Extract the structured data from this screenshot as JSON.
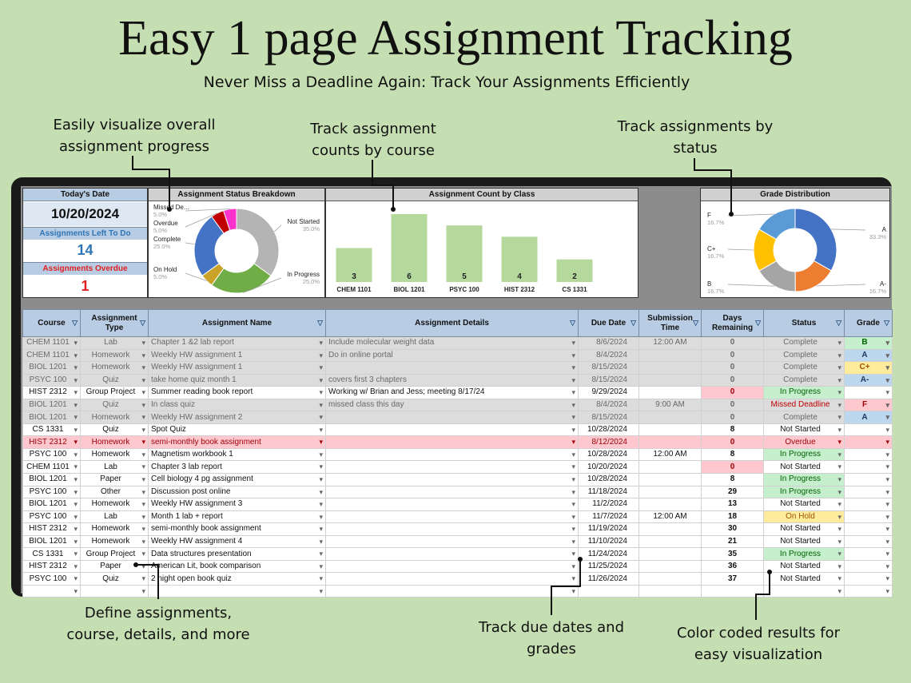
{
  "title": "Easy 1 page Assignment Tracking",
  "subtitle": "Never Miss a Deadline Again: Track Your Assignments Efficiently",
  "callouts": {
    "progress": [
      "Easily visualize overall",
      "assignment progress"
    ],
    "counts": [
      "Track assignment",
      "counts by course"
    ],
    "status": [
      "Track assignments by",
      "status"
    ],
    "define": [
      "Define assignments,",
      "course, details, and more"
    ],
    "due": [
      "Track due dates and",
      "grades"
    ],
    "color": [
      "Color coded results for",
      "easy visualization"
    ]
  },
  "kpis": {
    "today_label": "Today's Date",
    "today_value": "10/20/2024",
    "left_label": "Assignments Left To Do",
    "left_value": "14",
    "overdue_label": "Assignments Overdue",
    "overdue_value": "1",
    "colors": {
      "left": "#2e75b6",
      "overdue": "#e02020"
    }
  },
  "status_chart": {
    "title": "Assignment Status Breakdown",
    "slices": [
      {
        "label": "Not Started",
        "pct": "35.0%",
        "value": 35,
        "color": "#b4b4b4"
      },
      {
        "label": "In Progress",
        "pct": "25.0%",
        "value": 25,
        "color": "#70ad47"
      },
      {
        "label": "On Hold",
        "pct": "5.0%",
        "value": 5,
        "color": "#c9a227"
      },
      {
        "label": "Complete",
        "pct": "25.0%",
        "value": 25,
        "color": "#4472c4"
      },
      {
        "label": "Overdue",
        "pct": "5.0%",
        "value": 5,
        "color": "#c00000"
      },
      {
        "label": "Missed De...",
        "pct": "5.0%",
        "value": 5,
        "color": "#ff33cc"
      }
    ]
  },
  "chart_data": [
    {
      "type": "bar",
      "title": "Assignment Count by Class",
      "categories": [
        "CHEM 1101",
        "BIOL 1201",
        "PSYC 100",
        "HIST 2312",
        "CS 1331"
      ],
      "values": [
        3,
        6,
        5,
        4,
        2
      ],
      "color": "#b5d99c",
      "ylim": [
        0,
        6.5
      ]
    },
    {
      "type": "pie",
      "title": "Grade Distribution",
      "categories": [
        "A",
        "A-",
        "B",
        "C+",
        "F"
      ],
      "values": [
        33.3,
        16.7,
        16.7,
        16.7,
        16.7
      ],
      "labels": [
        "33.3%",
        "16.7%",
        "16.7%",
        "16.7%",
        "16.7%"
      ],
      "colors": [
        "#4472c4",
        "#ed7d31",
        "#a5a5a5",
        "#ffc000",
        "#5b9bd5"
      ]
    }
  ],
  "table": {
    "headers": [
      "Course",
      "Assignment Type",
      "Assignment Name",
      "Assignment Details",
      "Due Date",
      "Submission Time",
      "Days Remaining",
      "Status",
      "Grade"
    ],
    "rows": [
      {
        "style": "grey",
        "course": "CHEM 1101",
        "type": "Lab",
        "name": "Chapter 1 &2 lab report",
        "details": "Include molecular weight data",
        "due": "8/6/2024",
        "time": "12:00 AM",
        "days": "0",
        "status": "Complete",
        "grade": "B",
        "status_style": "",
        "days_style": "",
        "grade_style": "g-green"
      },
      {
        "style": "grey",
        "course": "CHEM 1101",
        "type": "Homework",
        "name": "Weekly HW assignment 1",
        "details": "Do in online portal",
        "due": "8/4/2024",
        "time": "",
        "days": "0",
        "status": "Complete",
        "grade": "A",
        "status_style": "",
        "days_style": "",
        "grade_style": "g-blue"
      },
      {
        "style": "grey",
        "course": "BIOL 1201",
        "type": "Homework",
        "name": "Weekly HW assignment 1",
        "details": "",
        "due": "8/15/2024",
        "time": "",
        "days": "0",
        "status": "Complete",
        "grade": "C+",
        "status_style": "",
        "days_style": "",
        "grade_style": "g-yellow"
      },
      {
        "style": "grey",
        "course": "PSYC 100",
        "type": "Quiz",
        "name": "take home quiz month 1",
        "details": "covers first 3 chapters",
        "due": "8/15/2024",
        "time": "",
        "days": "0",
        "status": "Complete",
        "grade": "A-",
        "status_style": "",
        "days_style": "",
        "grade_style": "g-blue"
      },
      {
        "style": "white",
        "course": "HIST 2312",
        "type": "Group Project",
        "name": "Summer reading book report",
        "details": "Working w/ Brian and Jess; meeting 8/17/24",
        "due": "9/29/2024",
        "time": "",
        "days": "0",
        "status": "In Progress",
        "grade": "",
        "status_style": "st-green",
        "days_style": "days-alert",
        "grade_style": ""
      },
      {
        "style": "grey",
        "course": "BIOL 1201",
        "type": "Quiz",
        "name": "In class quiz",
        "details": "missed class this day",
        "due": "8/4/2024",
        "time": "9:00 AM",
        "days": "0",
        "status": "Missed Deadline",
        "grade": "F",
        "status_style": "st-red",
        "days_style": "",
        "grade_style": "g-red"
      },
      {
        "style": "grey",
        "course": "BIOL 1201",
        "type": "Homework",
        "name": "Weekly HW assignment 2",
        "details": "",
        "due": "8/15/2024",
        "time": "",
        "days": "0",
        "status": "Complete",
        "grade": "A",
        "status_style": "",
        "days_style": "",
        "grade_style": "g-blue"
      },
      {
        "style": "white",
        "course": "CS 1331",
        "type": "Quiz",
        "name": "Spot Quiz",
        "details": "",
        "due": "10/28/2024",
        "time": "",
        "days": "8",
        "status": "Not Started",
        "grade": "",
        "status_style": "",
        "days_style": "",
        "grade_style": ""
      },
      {
        "style": "pink",
        "course": "HIST 2312",
        "type": "Homework",
        "name": "semi-monthly book assignment",
        "details": "",
        "due": "8/12/2024",
        "time": "",
        "days": "0",
        "status": "Overdue",
        "grade": "",
        "status_style": "",
        "days_style": "",
        "grade_style": ""
      },
      {
        "style": "white",
        "course": "PSYC 100",
        "type": "Homework",
        "name": "Magnetism workbook 1",
        "details": "",
        "due": "10/28/2024",
        "time": "12:00 AM",
        "days": "8",
        "status": "In Progress",
        "grade": "",
        "status_style": "st-green",
        "days_style": "",
        "grade_style": ""
      },
      {
        "style": "white",
        "course": "CHEM 1101",
        "type": "Lab",
        "name": "Chapter 3 lab report",
        "details": "",
        "due": "10/20/2024",
        "time": "",
        "days": "0",
        "status": "Not Started",
        "grade": "",
        "status_style": "",
        "days_style": "days-alert",
        "grade_style": ""
      },
      {
        "style": "white",
        "course": "BIOL 1201",
        "type": "Paper",
        "name": "Cell biology 4 pg assignment",
        "details": "",
        "due": "10/28/2024",
        "time": "",
        "days": "8",
        "status": "In Progress",
        "grade": "",
        "status_style": "st-green",
        "days_style": "",
        "grade_style": ""
      },
      {
        "style": "white",
        "course": "PSYC 100",
        "type": "Other",
        "name": "Discussion post online",
        "details": "",
        "due": "11/18/2024",
        "time": "",
        "days": "29",
        "status": "In Progress",
        "grade": "",
        "status_style": "st-green",
        "days_style": "",
        "grade_style": ""
      },
      {
        "style": "white",
        "course": "BIOL 1201",
        "type": "Homework",
        "name": "Weekly HW assignment 3",
        "details": "",
        "due": "11/2/2024",
        "time": "",
        "days": "13",
        "status": "Not Started",
        "grade": "",
        "status_style": "",
        "days_style": "",
        "grade_style": ""
      },
      {
        "style": "white",
        "course": "PSYC 100",
        "type": "Lab",
        "name": "Month 1 lab + report",
        "details": "",
        "due": "11/7/2024",
        "time": "12:00 AM",
        "days": "18",
        "status": "On Hold",
        "grade": "",
        "status_style": "st-yellow",
        "days_style": "",
        "grade_style": ""
      },
      {
        "style": "white",
        "course": "HIST 2312",
        "type": "Homework",
        "name": "semi-monthly book assignment",
        "details": "",
        "due": "11/19/2024",
        "time": "",
        "days": "30",
        "status": "Not Started",
        "grade": "",
        "status_style": "",
        "days_style": "",
        "grade_style": ""
      },
      {
        "style": "white",
        "course": "BIOL 1201",
        "type": "Homework",
        "name": "Weekly HW assignment 4",
        "details": "",
        "due": "11/10/2024",
        "time": "",
        "days": "21",
        "status": "Not Started",
        "grade": "",
        "status_style": "",
        "days_style": "",
        "grade_style": ""
      },
      {
        "style": "white",
        "course": "CS 1331",
        "type": "Group Project",
        "name": "Data structures presentation",
        "details": "",
        "due": "11/24/2024",
        "time": "",
        "days": "35",
        "status": "In Progress",
        "grade": "",
        "status_style": "st-green",
        "days_style": "",
        "grade_style": ""
      },
      {
        "style": "white",
        "course": "HIST 2312",
        "type": "Paper",
        "name": "American Lit, book comparison",
        "details": "",
        "due": "11/25/2024",
        "time": "",
        "days": "36",
        "status": "Not Started",
        "grade": "",
        "status_style": "",
        "days_style": "",
        "grade_style": ""
      },
      {
        "style": "white",
        "course": "PSYC 100",
        "type": "Quiz",
        "name": "2 night open book quiz",
        "details": "",
        "due": "11/26/2024",
        "time": "",
        "days": "37",
        "status": "Not Started",
        "grade": "",
        "status_style": "",
        "days_style": "",
        "grade_style": ""
      },
      {
        "style": "white",
        "course": "",
        "type": "",
        "name": "",
        "details": "",
        "due": "",
        "time": "",
        "days": "",
        "status": "",
        "grade": "",
        "status_style": "",
        "days_style": "",
        "grade_style": ""
      }
    ]
  }
}
